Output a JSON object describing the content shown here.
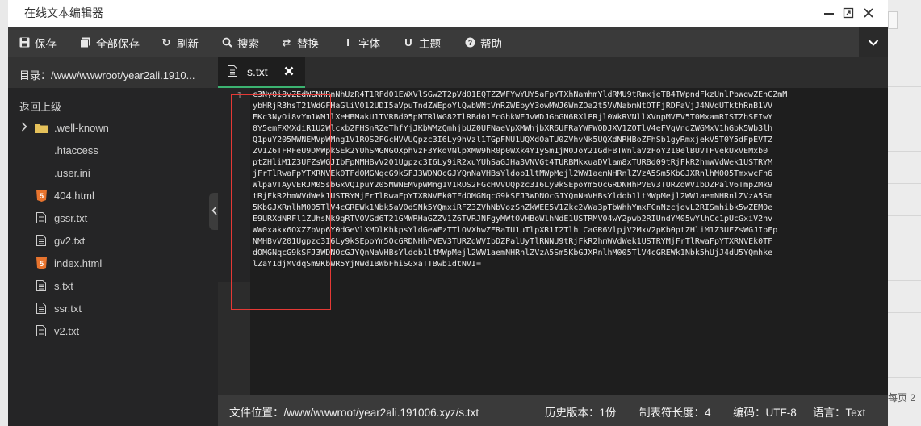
{
  "window": {
    "title": "在线文本编辑器"
  },
  "toolbar": {
    "buttons": [
      {
        "label": "保存",
        "icon": "save-icon"
      },
      {
        "label": "全部保存",
        "icon": "save-all-icon"
      },
      {
        "label": "刷新",
        "icon": "refresh-icon"
      },
      {
        "label": "搜索",
        "icon": "search-icon"
      },
      {
        "label": "替换",
        "icon": "replace-icon"
      },
      {
        "label": "字体",
        "icon": "font-icon"
      },
      {
        "label": "主题",
        "icon": "theme-icon"
      },
      {
        "label": "帮助",
        "icon": "help-icon"
      }
    ]
  },
  "sidebar": {
    "directory_label": "目录：/www/wwwroot/year2ali.1910...",
    "back_label": "返回上级",
    "files": [
      {
        "name": ".well-known",
        "type": "folder"
      },
      {
        "name": ".htaccess",
        "type": "plain"
      },
      {
        "name": ".user.ini",
        "type": "plain"
      },
      {
        "name": "404.html",
        "type": "html"
      },
      {
        "name": "gssr.txt",
        "type": "txt"
      },
      {
        "name": "gv2.txt",
        "type": "txt"
      },
      {
        "name": "index.html",
        "type": "html"
      },
      {
        "name": "s.txt",
        "type": "txt"
      },
      {
        "name": "ssr.txt",
        "type": "txt"
      },
      {
        "name": "v2.txt",
        "type": "txt"
      }
    ]
  },
  "tab": {
    "name": "s.txt"
  },
  "editor": {
    "line_number": "1",
    "lines": [
      "c3NyOi8vZEdWGNHRnNhUzR4T1RFd01EWXVlSGw2T2pVd01EQTZZWFYwYUY5aFpYTXhNamhmYldRMU9tRmxjeTB4TWpndFkzUnlPbWgwZEhCZmM",
      "ybHRjR3hsT21WdGFHaGliV012UDI5aVpuTndZWEpoYlQwbWNtVnRZWEpyY3owMWJ6WnZOa2t5VVNabmNtOTFjRDFaVjJ4NVdUTkthRnB1VV",
      "EKc3NyOi8vYm1WM1lXeHBMakU1TVRBd05pNTRlWG82TlRBd01EcGhkWFJvWDJGbGN6RXlPRjl0WkRVNllXVnpMVEV5T0MxamRISTZhSFIwY",
      "0Y5emFXMXdiR1U2Wlcxb2FHSnRZeThfYjJKbWMzQmhjbUZ0UFNaeVpXMWhjbXR6UFRaYWFWODJXV1ZOTlV4eFVqVndZWGMxV1hGbk5Wb3lh",
      "Q1puY205MWNEMVpWMng1V1ROS2FGcHVVUQpzc3I6Ly9hVzl1TGpFNU1UQXdOaTU0ZVhvNk5UQXdNRHBoZFhSb1gyRmxjekV5T0Y5dFpEVTZ",
      "ZV1Z6TFRFeU9DMWpkSEk2YUhSMGNGOXphVzF3YkdVNlpXMW9hR0p0WXk4Y1ySm1jM0JoY21GdFBTWnlaVzFoY210elBUVTFVekUxVEMxb0",
      "ptZHliM1Z3UFZsWGJIbFpNMHBvV201Ugpzc3I6Ly9iR2xuYUhSaGJHa3VNVGt4TURBMkxuaDVlam8xTURBd09tRjFkR2hmWVdWek1USTRYM",
      "jFrTlRwaFpYTXRNVEk0TFdOMGNqcG9kSFJ3WDNOcGJYQnNaVHBsYldob1ltMWpMejl2WW1aemNHRnlZVzA5Sm5KbGJXRnlhM005TmxwcFh6",
      "WlpaVTAyVERJM05sbGxVQ1puY205MWNEMVpWMng1V1ROS2FGcHVVUQpzc3I6Ly9kSEpoYm5OcGRDNHhPVEV3TURZdWVIbDZPalV6TmpZMk9",
      "tRjFkR2hmWVdWek1USTRYMjFrTlRwaFpYTXRNVEk0TFdOMGNqcG9kSFJ3WDNOcGJYQnNaVHBsYldob1ltMWpMejl2WW1aemNHRnlZVzA5Sm",
      "5KbGJXRnlhM005TlV4cGREWk1Nbk5aV0dSNk5YQmxiRFZ3ZVhNbVozSnZkWEE5V1Zkc2VWa3pTbWhhYmxFCnNzcjovL2RISmhibk5wZEM0e",
      "E9URXdNRFl1ZUhsNk9qRTVOVGd6T21GMWRHaGZZV1Z6TVRJNFgyMWtOVHBoWlhNdE1USTRMV04wY2pwb2RIUndYM05wYlhCc1pUcGxiV2hv",
      "WW0xakx6OXZZbVp6Y0dGeVlXMDlKbkpsYldGeWEzTTlOVXhwZERaTU1uTlpXR1I2Tlh CaGR6VlpjV2MxV2pKb0ptZHliM1Z3UFZsWGJIbFp",
      "NMHBvV201Ugpzc3I6Ly9kSEpoYm5OcGRDNHhPVEV3TURZdWVIbDZPalUyTlRNNU9tRjFkR2hmWVdWek1USTRYMjFrTlRwaFpYTXRNVEk0TF",
      "dOMGNqcG9kSFJ3WDNOcGJYQnNaVHBsYldob1ltMWpMejl2WW1aemNHRnlZVzA5Sm5KbGJXRnlhM005TlV4cGREWk1Nbk5hUjJ4dU5YQmhke",
      "lZaY1djMVdqSm9KbWR5YjNWd1BWbFhiSGxaTTBwb1dtNVI="
    ]
  },
  "status": {
    "file_location": "文件位置：/www/wwwroot/year2ali.191006.xyz/s.txt",
    "history": "历史版本：1份",
    "tab_size": "制表符长度：4",
    "encoding": "编码：UTF-8",
    "language": "语言：Text"
  },
  "right_strip": {
    "page_text": "每页 2"
  },
  "colors": {
    "toolbar_bg": "#3a3a3a",
    "editor_bg": "#1e1e1e",
    "sidebar_bg": "#252526",
    "tab_accent": "#3cb371",
    "html_icon": "#e8742e",
    "folder_icon": "#e5c15a",
    "highlight_box": "#e53935"
  }
}
